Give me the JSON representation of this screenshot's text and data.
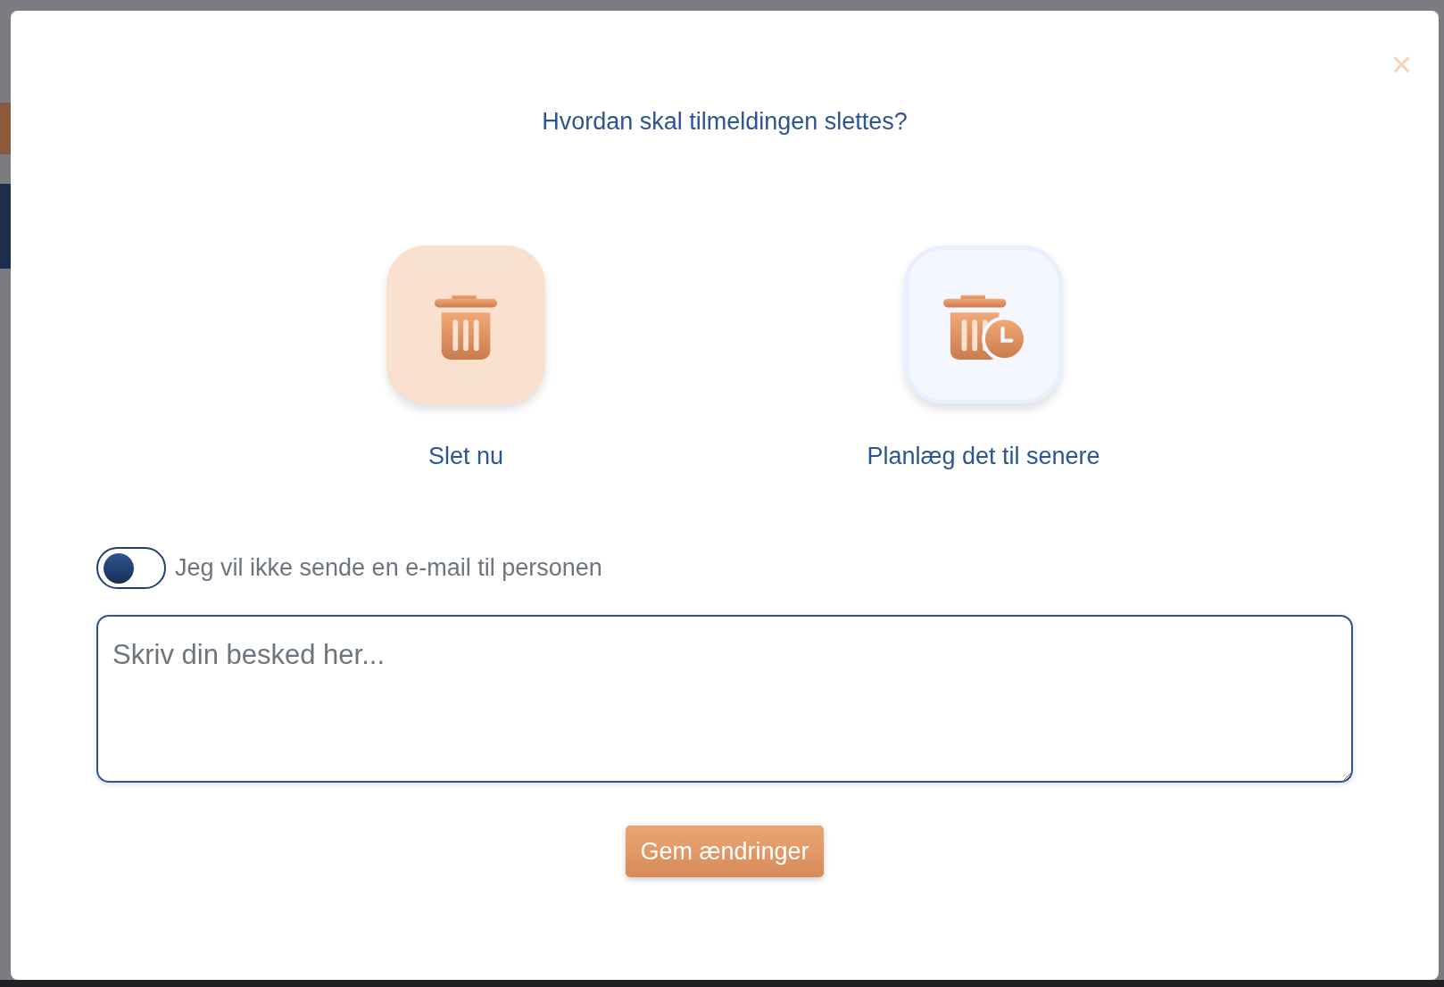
{
  "dialog": {
    "close_label": "×",
    "title": "Hvordan skal tilmeldingen slettes?",
    "options": [
      {
        "kind": "delete",
        "label": "Slet nu",
        "selected": true
      },
      {
        "kind": "schedule",
        "label": "Planlæg det til senere",
        "selected": false
      }
    ],
    "toggle": {
      "label": "Jeg vil ikke sende en e-mail til personen",
      "on": false
    },
    "message": {
      "placeholder": "Skriv din besked her..."
    },
    "save_button": "Gem ændringer"
  }
}
